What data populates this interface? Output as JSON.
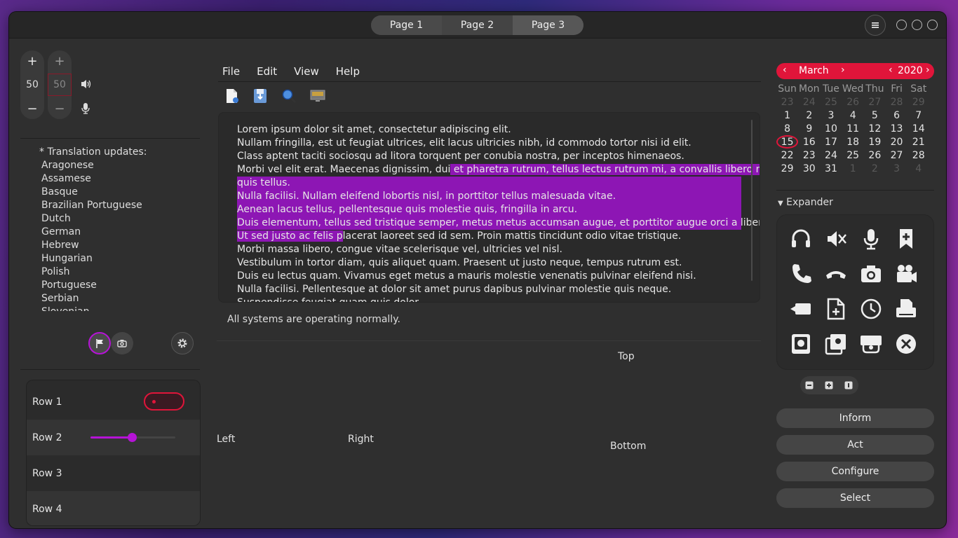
{
  "tabs": [
    "Page 1",
    "Page 2",
    "Page 3"
  ],
  "spin1": {
    "value": "50",
    "plus": "+",
    "minus": "−"
  },
  "spin2": {
    "value": "50",
    "plus": "+",
    "minus": "−"
  },
  "translations": {
    "header": "* Translation updates:",
    "items": [
      "Aragonese",
      "Assamese",
      "Basque",
      "Brazilian Portuguese",
      "Dutch",
      "German",
      "Hebrew",
      "Hungarian",
      "Polish",
      "Portuguese",
      "Serbian",
      "Slovenian"
    ]
  },
  "rows": [
    "Row 1",
    "Row 2",
    "Row 3",
    "Row 4"
  ],
  "slider_fraction": 0.49,
  "menu": [
    "File",
    "Edit",
    "View",
    "Help"
  ],
  "text": {
    "l1": "Lorem ipsum dolor sit amet, consectetur adipiscing elit.",
    "l2": "Nullam fringilla, est ut feugiat ultrices, elit lacus ultricies nibh, id commodo tortor nisi id elit.",
    "l3": "Class aptent taciti sociosqu ad litora torquent per conubia nostra, per inceptos himenaeos.",
    "l4a": "Morbi vel elit erat. Maecenas dignissim, dui",
    "l4b": " et pharetra rutrum, tellus lectus rutrum mi, a convallis libero nisi",
    "l5": "quis tellus.",
    "l6": "Nulla facilisi. Nullam eleifend lobortis nisl, in porttitor tellus malesuada vitae.",
    "l7": "Aenean lacus tellus, pellentesque quis molestie quis, fringilla in arcu.",
    "l8": "Duis elementum, tellus sed tristique semper, metus metus accumsan augue, et porttitor augue orci a libero.",
    "l9a": "Ut sed justo ac felis p",
    "l9b": "lacerat laoreet sed id sem. Proin mattis tincidunt odio vitae tristique.",
    "l10": "Morbi massa libero, congue vitae scelerisque vel, ultricies vel nisl.",
    "l11": "Vestibulum in tortor diam, quis aliquet quam. Praesent ut justo neque, tempus rutrum est.",
    "l12": "Duis eu lectus quam. Vivamus eget metus a mauris molestie venenatis pulvinar eleifend nisi.",
    "l13": "Nulla facilisi. Pellentesque at dolor sit amet purus dapibus pulvinar molestie quis neque.",
    "l14": "Suspendisse feugiat quam quis dolor"
  },
  "status": "All systems are operating normally.",
  "positions": {
    "top": "Top",
    "left": "Left",
    "right": "Right",
    "bottom": "Bottom"
  },
  "calendar": {
    "month": "March",
    "year": "2020",
    "weekdays": [
      "Sun",
      "Mon",
      "Tue",
      "Wed",
      "Thu",
      "Fri",
      "Sat"
    ],
    "prev_days": [
      "23",
      "24",
      "25",
      "26",
      "27",
      "28",
      "29"
    ],
    "days": [
      "1",
      "2",
      "3",
      "4",
      "5",
      "6",
      "7",
      "8",
      "9",
      "10",
      "11",
      "12",
      "13",
      "14",
      "15",
      "16",
      "17",
      "18",
      "19",
      "20",
      "21",
      "22",
      "23",
      "24",
      "25",
      "26",
      "27",
      "28",
      "29",
      "30",
      "31"
    ],
    "next_days": [
      "1",
      "2",
      "3",
      "4"
    ],
    "today": "15"
  },
  "expander": "Expander",
  "buttons": [
    "Inform",
    "Act",
    "Configure",
    "Select"
  ],
  "colors": {
    "accent": "#e0153a",
    "selection": "#8d16b4",
    "purple": "#b513d6"
  }
}
